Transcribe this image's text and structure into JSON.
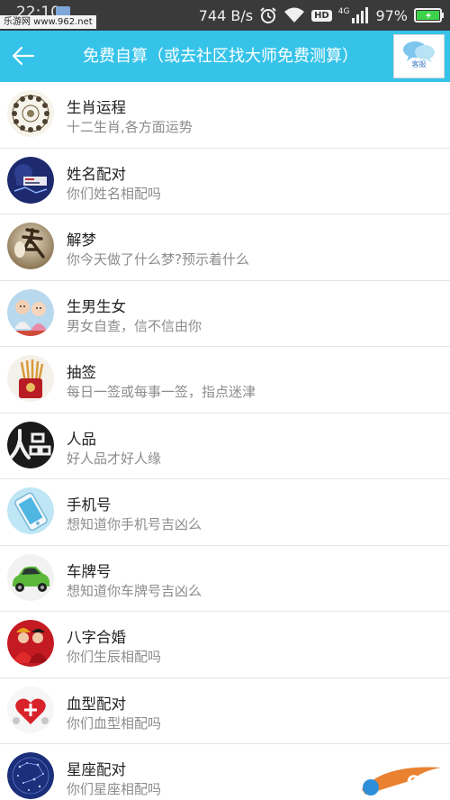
{
  "status_bar": {
    "time": "22:10",
    "watermark": "乐游网 www.962.net",
    "net_speed": "744 B/s",
    "hd_badge": "HD",
    "network_type": "4G",
    "battery": "97%"
  },
  "header": {
    "title": "免费自算（或去社区找大师免费测算）",
    "service_label": "客服"
  },
  "items": [
    {
      "title": "生肖运程",
      "subtitle": "十二生肖,各方面运势",
      "icon": "zodiac-wheel-icon"
    },
    {
      "title": "姓名配对",
      "subtitle": "你们姓名相配吗",
      "icon": "name-match-icon"
    },
    {
      "title": "解梦",
      "subtitle": "你今天做了什么梦?预示着什么",
      "icon": "dream-icon"
    },
    {
      "title": "生男生女",
      "subtitle": "男女自查，信不信由你",
      "icon": "babies-icon"
    },
    {
      "title": "抽签",
      "subtitle": "每日一签或每事一签，指点迷津",
      "icon": "fortune-sticks-icon"
    },
    {
      "title": "人品",
      "subtitle": "好人品才好人缘",
      "icon": "character-icon"
    },
    {
      "title": "手机号",
      "subtitle": "想知道你手机号吉凶么",
      "icon": "phone-icon"
    },
    {
      "title": "车牌号",
      "subtitle": "想知道你车牌号吉凶么",
      "icon": "car-icon"
    },
    {
      "title": "八字合婚",
      "subtitle": "你们生辰相配吗",
      "icon": "wedding-icon"
    },
    {
      "title": "血型配对",
      "subtitle": "你们血型相配吗",
      "icon": "blood-type-icon"
    },
    {
      "title": "星座配对",
      "subtitle": "你们星座相配吗",
      "icon": "constellation-icon"
    }
  ],
  "logo": {
    "text": "962",
    "sub": "乐游网"
  }
}
